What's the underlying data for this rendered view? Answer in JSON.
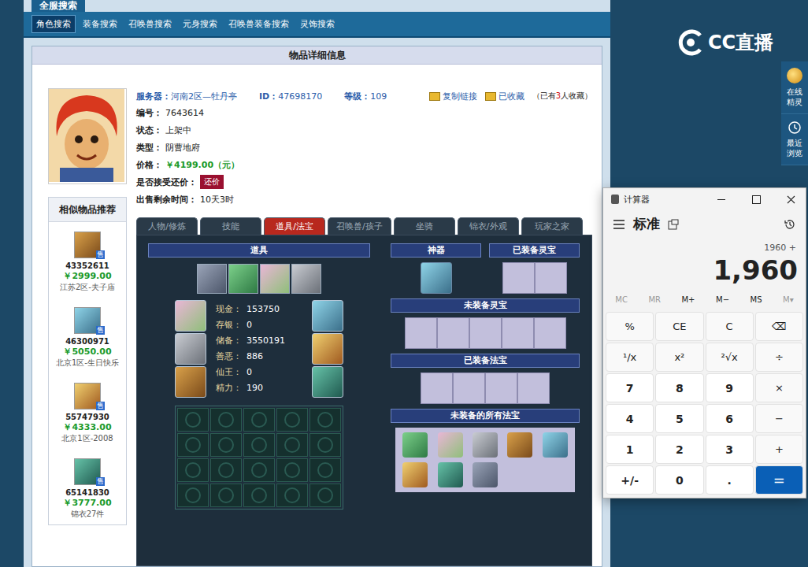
{
  "nav": {
    "title": "全服搜索",
    "tabs": [
      {
        "label": "角色搜索",
        "selected": true
      },
      {
        "label": "装备搜索",
        "selected": false
      },
      {
        "label": "召唤兽搜索",
        "selected": false
      },
      {
        "label": "元身搜索",
        "selected": false
      },
      {
        "label": "召唤兽装备搜索",
        "selected": false
      },
      {
        "label": "灵饰搜索",
        "selected": false
      }
    ]
  },
  "detail": {
    "title": "物品详细信息"
  },
  "info": {
    "server_label": "服务器：",
    "server": "河南2区—牡丹亭",
    "id_label": "ID：",
    "id": "47698170",
    "level_label": "等级：",
    "level": "109",
    "links": [
      {
        "label": "复制链接"
      },
      {
        "label": "已收藏"
      }
    ],
    "fav_pre": "（已有",
    "fav_count": "3",
    "fav_post": "人收藏）",
    "fields": [
      {
        "label": "编号：",
        "value": "7643614",
        "kind": "plain"
      },
      {
        "label": "状态：",
        "value": "上架中",
        "kind": "plain"
      },
      {
        "label": "类型：",
        "value": "阴曹地府",
        "kind": "plain"
      },
      {
        "label": "价格：",
        "value": "￥4199.00（元）",
        "kind": "price"
      },
      {
        "label": "是否接受还价：",
        "value": "还价",
        "kind": "button"
      },
      {
        "label": "出售剩余时间：",
        "value": "10天3时",
        "kind": "plain"
      }
    ]
  },
  "similar": {
    "title": "相似物品推荐",
    "badge": "售",
    "items": [
      {
        "id": "43352611",
        "price": "￥2999.00",
        "server": "江苏2区-夫子庙"
      },
      {
        "id": "46300971",
        "price": "￥5050.00",
        "server": "北京1区-生日快乐"
      },
      {
        "id": "55747930",
        "price": "￥4333.00",
        "server": "北京1区-2008"
      },
      {
        "id": "65141830",
        "price": "￥3777.00",
        "server": "锦衣27件"
      }
    ]
  },
  "detail_tabs": [
    {
      "label": "人物/修炼",
      "selected": false
    },
    {
      "label": "技能",
      "selected": false
    },
    {
      "label": "道具/法宝",
      "selected": true
    },
    {
      "label": "召唤兽/孩子",
      "selected": false
    },
    {
      "label": "坐骑",
      "selected": false
    },
    {
      "label": "锦衣/外观",
      "selected": false
    },
    {
      "label": "玩家之家",
      "selected": false
    }
  ],
  "items_panel": {
    "title": "道具",
    "top_items": [
      {
        "filled": true
      },
      {
        "filled": true
      },
      {
        "filled": true
      },
      {
        "filled": true
      }
    ],
    "left_equip": [
      {
        "filled": true
      },
      {
        "filled": true
      },
      {
        "filled": true
      }
    ],
    "right_equip": [
      {
        "filled": true
      },
      {
        "filled": true
      },
      {
        "filled": true
      }
    ],
    "stats": [
      {
        "label": "现金：",
        "value": "153750"
      },
      {
        "label": "存银：",
        "value": "0"
      },
      {
        "label": "储备：",
        "value": "3550191"
      },
      {
        "label": "善恶：",
        "value": "886"
      },
      {
        "label": "仙王：",
        "value": "0"
      },
      {
        "label": "精力：",
        "value": "190"
      }
    ],
    "bag": [
      {
        "filled": false
      },
      {
        "filled": false
      },
      {
        "filled": false
      },
      {
        "filled": false
      },
      {
        "filled": false
      },
      {
        "filled": false
      },
      {
        "filled": false
      },
      {
        "filled": false
      },
      {
        "filled": false
      },
      {
        "filled": false
      },
      {
        "filled": false
      },
      {
        "filled": false
      },
      {
        "filled": false
      },
      {
        "filled": false
      },
      {
        "filled": false
      },
      {
        "filled": false
      },
      {
        "filled": false
      },
      {
        "filled": false
      },
      {
        "filled": false
      },
      {
        "filled": false
      }
    ]
  },
  "treasure_panel": {
    "artifact_title": "神器",
    "artifact": [
      {
        "filled": true
      }
    ],
    "equipped_lingbao_title": "已装备灵宝",
    "equipped_lingbao": [
      {
        "filled": false
      },
      {
        "filled": false
      }
    ],
    "unequipped_lingbao_title": "未装备灵宝",
    "unequipped_lingbao": [
      {
        "filled": false
      },
      {
        "filled": false
      },
      {
        "filled": false
      },
      {
        "filled": false
      },
      {
        "filled": false
      }
    ],
    "equipped_fabao_title": "已装备法宝",
    "equipped_fabao": [
      {
        "filled": false
      },
      {
        "filled": false
      },
      {
        "filled": false
      },
      {
        "filled": false
      }
    ],
    "all_fabao_title": "未装备的所有法宝",
    "all_fabao": [
      {
        "filled": true
      },
      {
        "filled": true
      },
      {
        "filled": true
      },
      {
        "filled": true
      },
      {
        "filled": true
      },
      {
        "filled": true
      },
      {
        "filled": true
      },
      {
        "filled": true
      },
      {
        "filled": false
      },
      {
        "filled": false
      }
    ]
  },
  "logo": {
    "text": "CC直播"
  },
  "side_tools": [
    {
      "label": "在线精灵"
    },
    {
      "label": "最近浏览"
    }
  ],
  "calculator": {
    "title": "计算器",
    "mode": "标准",
    "expression": "1960 +",
    "display": "1,960",
    "memory": [
      {
        "label": "MC",
        "disabled": true
      },
      {
        "label": "MR",
        "disabled": true
      },
      {
        "label": "M+",
        "disabled": false
      },
      {
        "label": "M−",
        "disabled": false
      },
      {
        "label": "MS",
        "disabled": false
      },
      {
        "label": "M▾",
        "disabled": true
      }
    ],
    "keys": [
      {
        "label": "%",
        "kind": "function"
      },
      {
        "label": "CE",
        "kind": "function"
      },
      {
        "label": "C",
        "kind": "function"
      },
      {
        "label": "⌫",
        "kind": "function"
      },
      {
        "label": "¹/x",
        "kind": "function"
      },
      {
        "label": "x²",
        "kind": "function"
      },
      {
        "label": "²√x",
        "kind": "function"
      },
      {
        "label": "÷",
        "kind": "function"
      },
      {
        "label": "7",
        "kind": "number"
      },
      {
        "label": "8",
        "kind": "number"
      },
      {
        "label": "9",
        "kind": "number"
      },
      {
        "label": "×",
        "kind": "function"
      },
      {
        "label": "4",
        "kind": "number"
      },
      {
        "label": "5",
        "kind": "number"
      },
      {
        "label": "6",
        "kind": "number"
      },
      {
        "label": "−",
        "kind": "function"
      },
      {
        "label": "1",
        "kind": "number"
      },
      {
        "label": "2",
        "kind": "number"
      },
      {
        "label": "3",
        "kind": "number"
      },
      {
        "label": "+",
        "kind": "function"
      },
      {
        "label": "+/-",
        "kind": "number"
      },
      {
        "label": "0",
        "kind": "number"
      },
      {
        "label": ".",
        "kind": "number"
      },
      {
        "label": "=",
        "kind": "equals"
      }
    ]
  }
}
